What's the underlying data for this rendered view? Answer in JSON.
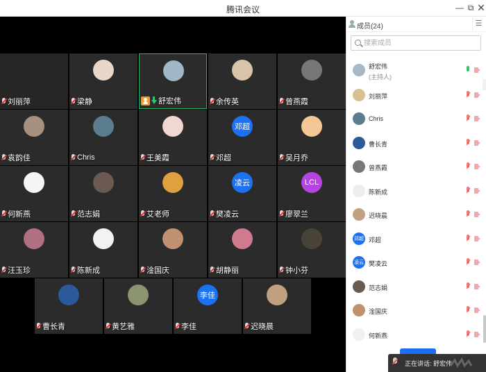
{
  "window": {
    "title": "腾讯会议"
  },
  "video_grid": {
    "rows": [
      {
        "tiles": [
          {
            "name": "刘丽萍",
            "avatar": "blank"
          },
          {
            "name": "梁静",
            "avatar": "photo-girl",
            "color": "#e8d6c8"
          },
          {
            "name": "舒宏伟",
            "avatar": "photo-silhouette",
            "color": "#9fb7c7",
            "host": true,
            "speaking": true
          },
          {
            "name": "余传英",
            "avatar": "photo-cartoon",
            "color": "#d8c4a8"
          },
          {
            "name": "曾燕霞",
            "avatar": "photo-portrait",
            "color": "#777777"
          }
        ]
      },
      {
        "tiles": [
          {
            "name": "袁韵佳",
            "avatar": "photo-group",
            "color": "#a89080"
          },
          {
            "name": "Chris",
            "avatar": "photo-landscape",
            "color": "#5a7d90"
          },
          {
            "name": "王美霞",
            "avatar": "photo-anime",
            "color": "#f0d8d0"
          },
          {
            "name": "邓超",
            "avatar_text": "邓超",
            "color": "#1d72f2"
          },
          {
            "name": "吴月乔",
            "avatar": "photo-baby",
            "color": "#f4c896"
          }
        ]
      },
      {
        "tiles": [
          {
            "name": "何新燕",
            "avatar": "photo-white",
            "color": "#f5f5f5"
          },
          {
            "name": "范志娟",
            "avatar": "photo-woman",
            "color": "#6a5a50"
          },
          {
            "name": "艾老师",
            "avatar": "photo-lion",
            "color": "#e0a040"
          },
          {
            "name": "樊凌云",
            "avatar_text": "凌云",
            "color": "#1d72f2"
          },
          {
            "name": "廖翠兰",
            "avatar_text": "LCL",
            "color": "#b544e0"
          }
        ]
      },
      {
        "tiles": [
          {
            "name": "汪玉珍",
            "avatar": "photo-flower",
            "color": "#b07080"
          },
          {
            "name": "陈新成",
            "avatar": "photo-sketch",
            "color": "#f2f2f2"
          },
          {
            "name": "淦国庆",
            "avatar": "photo-man",
            "color": "#c09070"
          },
          {
            "name": "胡静丽",
            "avatar": "photo-flowers",
            "color": "#d07a90"
          },
          {
            "name": "钟小芬",
            "avatar": "photo-dark",
            "color": "#4a4438"
          }
        ]
      },
      {
        "tiles": [
          {
            "name": "曹长青",
            "avatar": "photo-earth",
            "color": "#2a5a9a"
          },
          {
            "name": "黄艺雅",
            "avatar": "photo-plants",
            "color": "#8a9470"
          },
          {
            "name": "李佳",
            "avatar_text": "李佳",
            "color": "#1d72f2"
          },
          {
            "name": "迟晓晨",
            "avatar": "photo-lady",
            "color": "#c0a080"
          }
        ]
      }
    ]
  },
  "members_panel": {
    "header": "成员(24)",
    "search_placeholder": "搜索成员",
    "members": [
      {
        "name": "舒宏伟",
        "sub": "(主持人)",
        "color": "#a8b8c4",
        "mic": "on"
      },
      {
        "name": "刘丽萍",
        "color": "#d8c090",
        "mic": "off"
      },
      {
        "name": "Chris",
        "color": "#5a7d90",
        "mic": "off"
      },
      {
        "name": "曹长青",
        "color": "#2a5a9a",
        "mic": "off"
      },
      {
        "name": "曾燕霞",
        "color": "#777777",
        "mic": "off"
      },
      {
        "name": "陈新成",
        "color": "#eeeeee",
        "mic": "off"
      },
      {
        "name": "迟晓晨",
        "color": "#c0a080",
        "mic": "off"
      },
      {
        "name": "邓超",
        "avatar_text": "邓超",
        "color": "#1d72f2",
        "mic": "off"
      },
      {
        "name": "樊凌云",
        "avatar_text": "凌云",
        "color": "#1d72f2",
        "mic": "off"
      },
      {
        "name": "范志娟",
        "color": "#6a5a50",
        "mic": "off"
      },
      {
        "name": "淦国庆",
        "color": "#c09070",
        "mic": "off"
      },
      {
        "name": "何新燕",
        "color": "#f0f0f0",
        "mic": "off"
      }
    ]
  },
  "speaking_bar": {
    "text": "正在讲话: 舒宏伟"
  }
}
